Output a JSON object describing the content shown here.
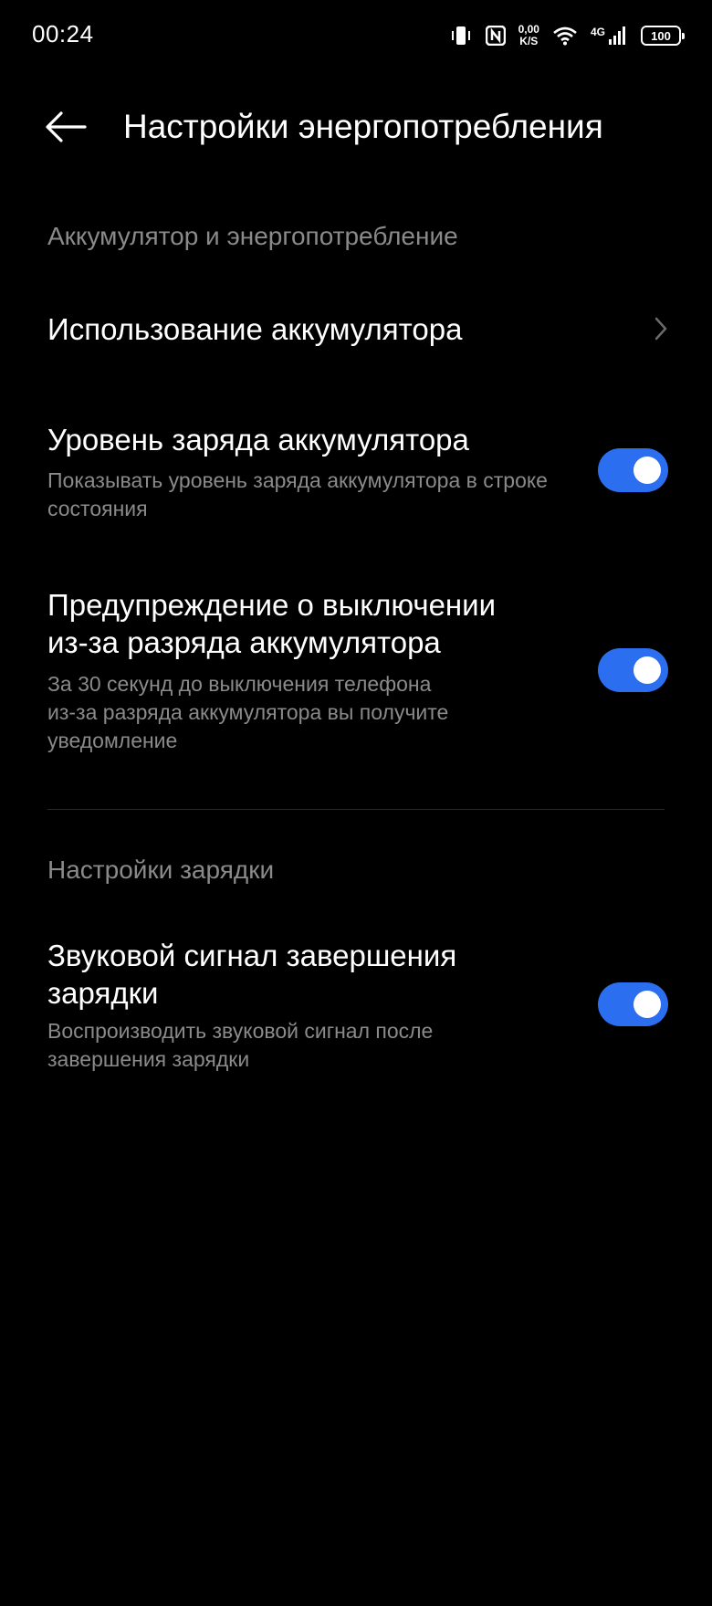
{
  "status_bar": {
    "time": "00:24",
    "net_speed_value": "0,00",
    "net_speed_unit": "K/S",
    "network_type": "4G",
    "battery_level": "100",
    "icons": [
      "vibrate-icon",
      "nfc-icon",
      "wifi-icon",
      "signal-icon",
      "battery-icon"
    ]
  },
  "header": {
    "title": "Настройки энергопотребления",
    "back_icon": "arrow-left-icon"
  },
  "sections": [
    {
      "label": "Аккумулятор и энергопотребление",
      "items": [
        {
          "title": "Использование аккумулятора",
          "control": "chevron"
        },
        {
          "title": "Уровень заряда аккумулятора",
          "description": "Показывать уровень заряда аккумулятора в строке состояния",
          "control": "toggle",
          "enabled": true
        },
        {
          "title_line1": "Предупреждение о выключении",
          "title_line2": "из-за разряда аккумулятора",
          "description_line1": "За 30 секунд до выключения телефона",
          "description_line2": "из-за разряда аккумулятора вы получите",
          "description_line3": "уведомление",
          "control": "toggle",
          "enabled": true
        }
      ]
    },
    {
      "label": "Настройки зарядки",
      "items": [
        {
          "title_line1": "Звуковой сигнал завершения",
          "title_line2": "зарядки",
          "description_line1": "Воспроизводить звуковой сигнал после",
          "description_line2": "завершения зарядки",
          "control": "toggle",
          "enabled": true
        }
      ]
    }
  ],
  "colors": {
    "background": "#000000",
    "primary_text": "#ffffff",
    "secondary_text": "#8a8a8a",
    "toggle_on": "#2b6ff0",
    "divider": "#2a2a2a"
  }
}
